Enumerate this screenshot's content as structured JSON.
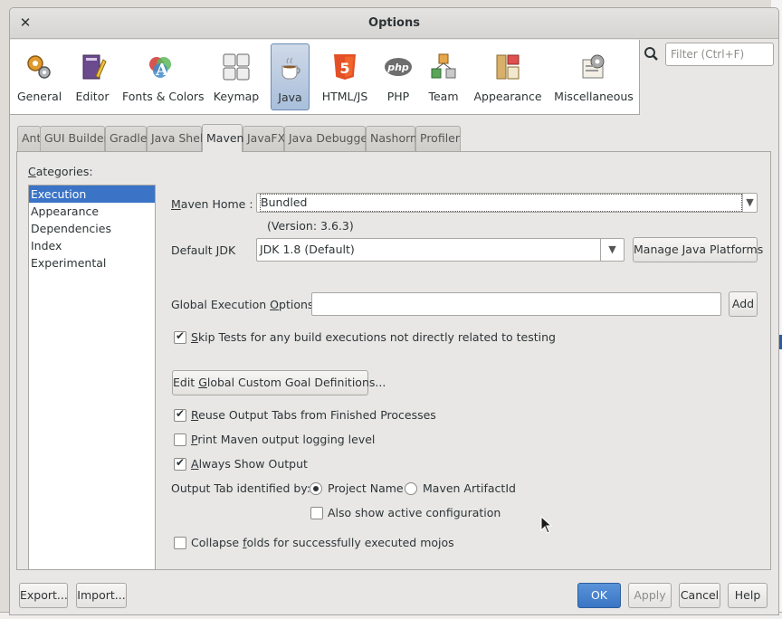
{
  "window": {
    "title": "Options"
  },
  "categories": [
    {
      "label": "General",
      "icon": "gears-icon"
    },
    {
      "label": "Editor",
      "icon": "editor-icon"
    },
    {
      "label": "Fonts & Colors",
      "icon": "fonts-colors-icon"
    },
    {
      "label": "Keymap",
      "icon": "keymap-icon"
    },
    {
      "label": "Java",
      "icon": "java-cup-icon",
      "selected": true
    },
    {
      "label": "HTML/JS",
      "icon": "html5-icon"
    },
    {
      "label": "PHP",
      "icon": "php-icon"
    },
    {
      "label": "Team",
      "icon": "team-cubes-icon"
    },
    {
      "label": "Appearance",
      "icon": "appearance-icon"
    },
    {
      "label": "Miscellaneous",
      "icon": "miscellaneous-icon"
    }
  ],
  "filter": {
    "placeholder": "Filter (Ctrl+F)",
    "value": ""
  },
  "tabs": [
    "Ant",
    "GUI Builder",
    "Gradle",
    "Java Shell",
    "Maven",
    "JavaFX",
    "Java Debugger",
    "Nashorn",
    "Profiler"
  ],
  "active_tab": "Maven",
  "maven": {
    "categories_label_first": "C",
    "categories_label_rest": "ategories:",
    "category_items": [
      "Execution",
      "Appearance",
      "Dependencies",
      "Index",
      "Experimental"
    ],
    "selected_category": "Execution",
    "maven_home_first": "M",
    "maven_home_rest": "aven Home :",
    "maven_home_value": "Bundled",
    "version_text": "(Version: 3.6.3)",
    "default_jdk_pre": "Default ",
    "default_jdk_u": "J",
    "default_jdk_post": "DK",
    "default_jdk_value": "JDK 1.8 (Default)",
    "manage_platforms": "Manage Java Platforms",
    "global_options_pre": "Global Execution ",
    "global_options_u": "O",
    "global_options_post": "ptions:",
    "global_options_value": "",
    "add_button": "Add",
    "skip_tests_u": "S",
    "skip_tests_rest": "kip Tests for any build executions not directly related to testing",
    "skip_tests_checked": true,
    "edit_goals_pre": "Edit ",
    "edit_goals_u": "G",
    "edit_goals_post": "lobal Custom Goal Definitions...",
    "reuse_tabs_u": "R",
    "reuse_tabs_rest": "euse Output Tabs from Finished Processes",
    "reuse_tabs_checked": true,
    "print_logging_u": "P",
    "print_logging_rest": "rint Maven output logging level",
    "print_logging_checked": false,
    "always_show_u": "A",
    "always_show_rest": "lways Show Output",
    "always_show_checked": true,
    "output_tab_label": "Output Tab identified by:",
    "radio_project_name": "Project Name",
    "radio_artifact_id": "Maven ArtifactId",
    "selected_radio": "Project Name",
    "also_show_active": "Also show active configuration",
    "also_show_active_checked": false,
    "collapse_pre": "Collapse ",
    "collapse_u": "f",
    "collapse_post": "olds for successfully executed mojos",
    "collapse_checked": false
  },
  "footer": {
    "export": "Export...",
    "import": "Import...",
    "ok": "OK",
    "apply": "Apply",
    "cancel": "Cancel",
    "help": "Help"
  },
  "colors": {
    "selection_blue": "#3b74c6",
    "primary_button": "#4a86d0",
    "window_bg": "#e8e7e6"
  }
}
